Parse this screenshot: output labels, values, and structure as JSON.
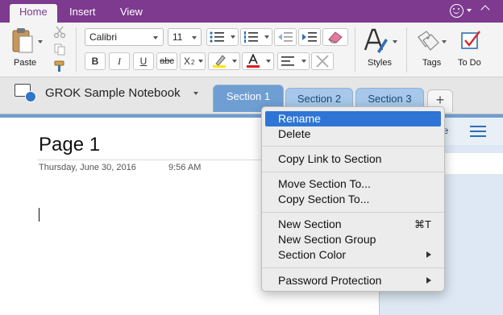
{
  "menubar": {
    "tabs": [
      {
        "label": "Home"
      },
      {
        "label": "Insert"
      },
      {
        "label": "View"
      }
    ]
  },
  "ribbon": {
    "paste_label": "Paste",
    "font": "Calibri",
    "size": "11",
    "bold": "B",
    "italic": "I",
    "underline": "U",
    "strike": "abc",
    "subscript": "X",
    "subscript_small": "2",
    "styles_label": "Styles",
    "tags_label": "Tags",
    "todo_label": "To Do"
  },
  "notebook": {
    "name": "GROK Sample Notebook",
    "sections": [
      {
        "label": "Section 1"
      },
      {
        "label": "Section 2"
      },
      {
        "label": "Section 3"
      }
    ],
    "add_symbol": "+"
  },
  "page": {
    "title": "Page 1",
    "date": "Thursday, June 30, 2016",
    "time": "9:56 AM"
  },
  "pane": {
    "add_label": "ge"
  },
  "context_menu": {
    "items": [
      {
        "label": "Rename"
      },
      {
        "label": "Delete"
      },
      {
        "label": "Copy Link to Section"
      },
      {
        "label": "Move Section To..."
      },
      {
        "label": "Copy Section To..."
      },
      {
        "label": "New Section",
        "shortcut": "⌘T"
      },
      {
        "label": "New Section Group"
      },
      {
        "label": "Section Color"
      },
      {
        "label": "Password Protection"
      }
    ]
  },
  "colors": {
    "menubar": "#7d3a8f",
    "active_section": "#6f9fd2",
    "section_tab": "#a7c8ea",
    "menu_highlight": "#2f75d6",
    "highlight_yellow": "#ffe600",
    "font_color_red": "#e01c1c"
  }
}
